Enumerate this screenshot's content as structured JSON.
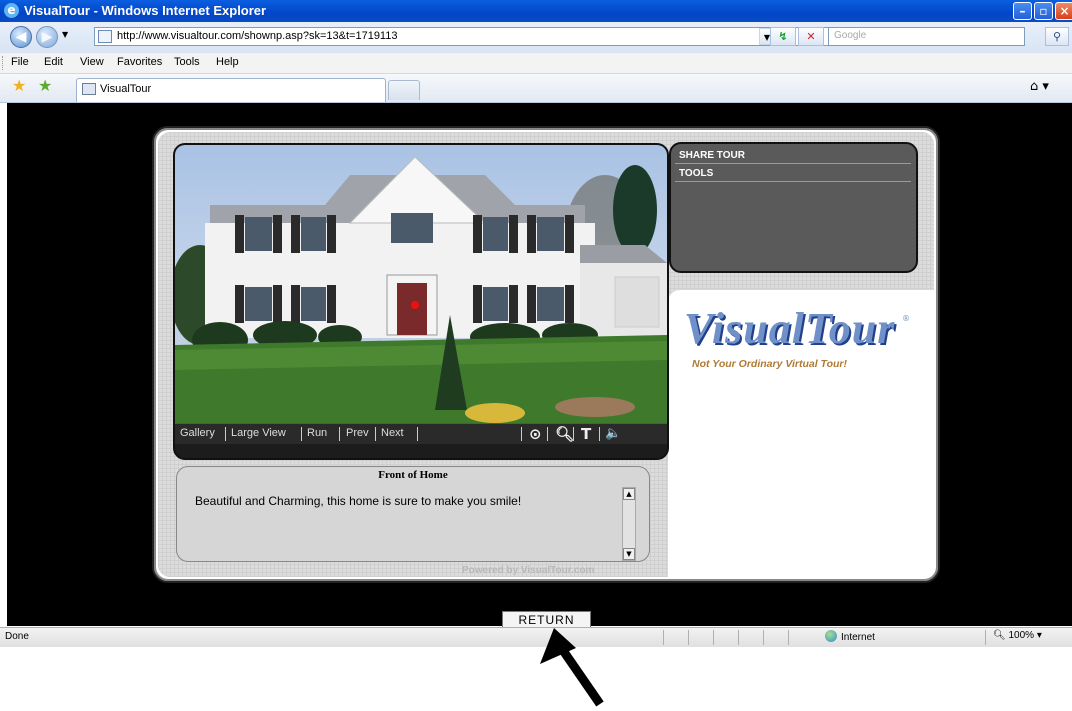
{
  "window": {
    "title": "VisualTour - Windows Internet Explorer"
  },
  "address_bar": {
    "url": "http://www.visualtour.com/shownp.asp?sk=13&t=1719113",
    "search_placeholder": "Google"
  },
  "menu": [
    "File",
    "Edit",
    "View",
    "Favorites",
    "Tools",
    "Help"
  ],
  "tab": {
    "label": "VisualTour"
  },
  "viewer": {
    "links": [
      "Gallery",
      "Large View",
      "Run",
      "Prev",
      "Next"
    ],
    "icons": [
      "target-icon",
      "zoom-icon",
      "text-icon",
      "speaker-icon"
    ],
    "icon_glyphs": [
      "⊙",
      "🔍︎",
      "T",
      "🔈"
    ]
  },
  "side_menu": {
    "items": [
      "SHARE TOUR",
      "TOOLS"
    ]
  },
  "logo": {
    "text": "VisualTour",
    "tagline": "Not Your Ordinary Virtual Tour!",
    "mark": "®",
    "tm": "™"
  },
  "description": {
    "title": "Front of Home",
    "text": "Beautiful and Charming, this home is sure to make you smile!"
  },
  "powered_by": "Powered by VisualTour.com",
  "return_button": "RETURN",
  "status": {
    "text": "Done",
    "zone": "Internet",
    "zoom": "100%"
  },
  "colors": {
    "accent": "#0a4cc4",
    "brand_blue": "#6f90c8",
    "brand_gold": "#b07a34"
  }
}
